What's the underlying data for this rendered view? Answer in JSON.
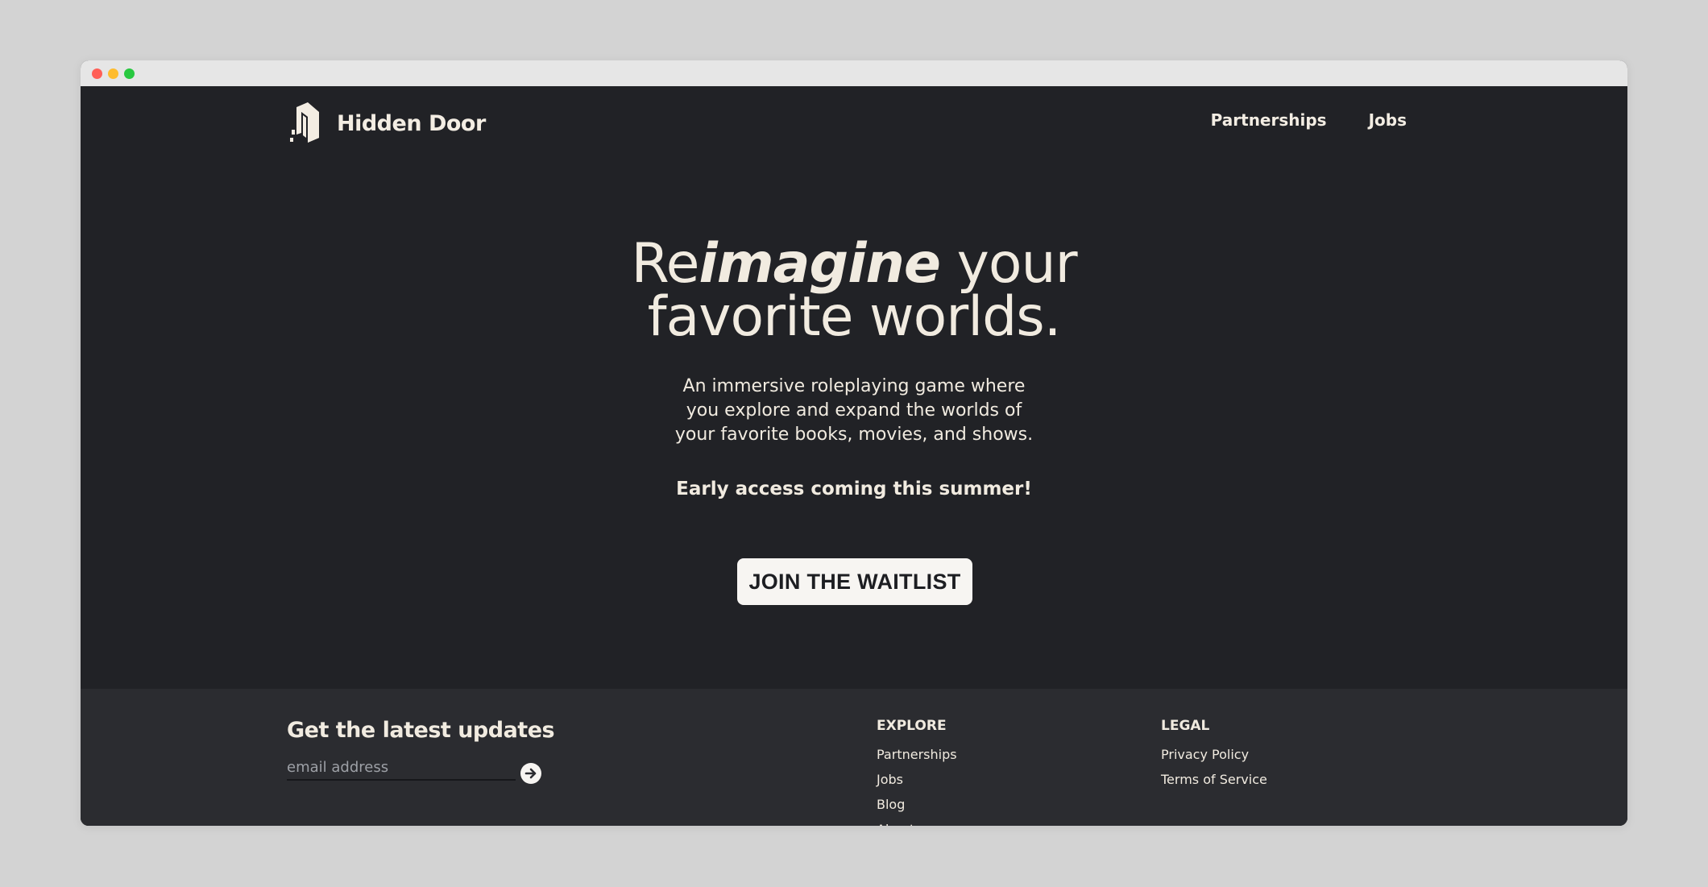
{
  "brand": {
    "name": "Hidden Door"
  },
  "nav": {
    "items": [
      "Partnerships",
      "Jobs"
    ]
  },
  "hero": {
    "headline_prefix": "Re",
    "headline_emphasis": "imagine",
    "headline_suffix": " your",
    "headline_line2": "favorite worlds.",
    "subtext_lines": [
      "An immersive roleplaying game where",
      "you explore and expand the worlds of",
      "your favorite books, movies, and shows."
    ],
    "early_access": "Early access coming this summer!",
    "cta_label": "JOIN THE WAITLIST"
  },
  "footer": {
    "updates_title": "Get the latest updates",
    "email_placeholder": "email address",
    "submit_icon": "arrow-right-circle-icon",
    "explore": {
      "title": "EXPLORE",
      "links": [
        "Partnerships",
        "Jobs",
        "Blog",
        "About"
      ]
    },
    "legal": {
      "title": "LEGAL",
      "links": [
        "Privacy Policy",
        "Terms of Service"
      ]
    }
  },
  "colors": {
    "page_background": "#212226",
    "footer_background": "#2b2c30",
    "text_cream": "#f1ebe0",
    "button_background": "#f7f5f2",
    "browser_chrome": "#e6e6e6",
    "traffic_red": "#ff5f57",
    "traffic_yellow": "#febc2e",
    "traffic_green": "#28c840"
  }
}
